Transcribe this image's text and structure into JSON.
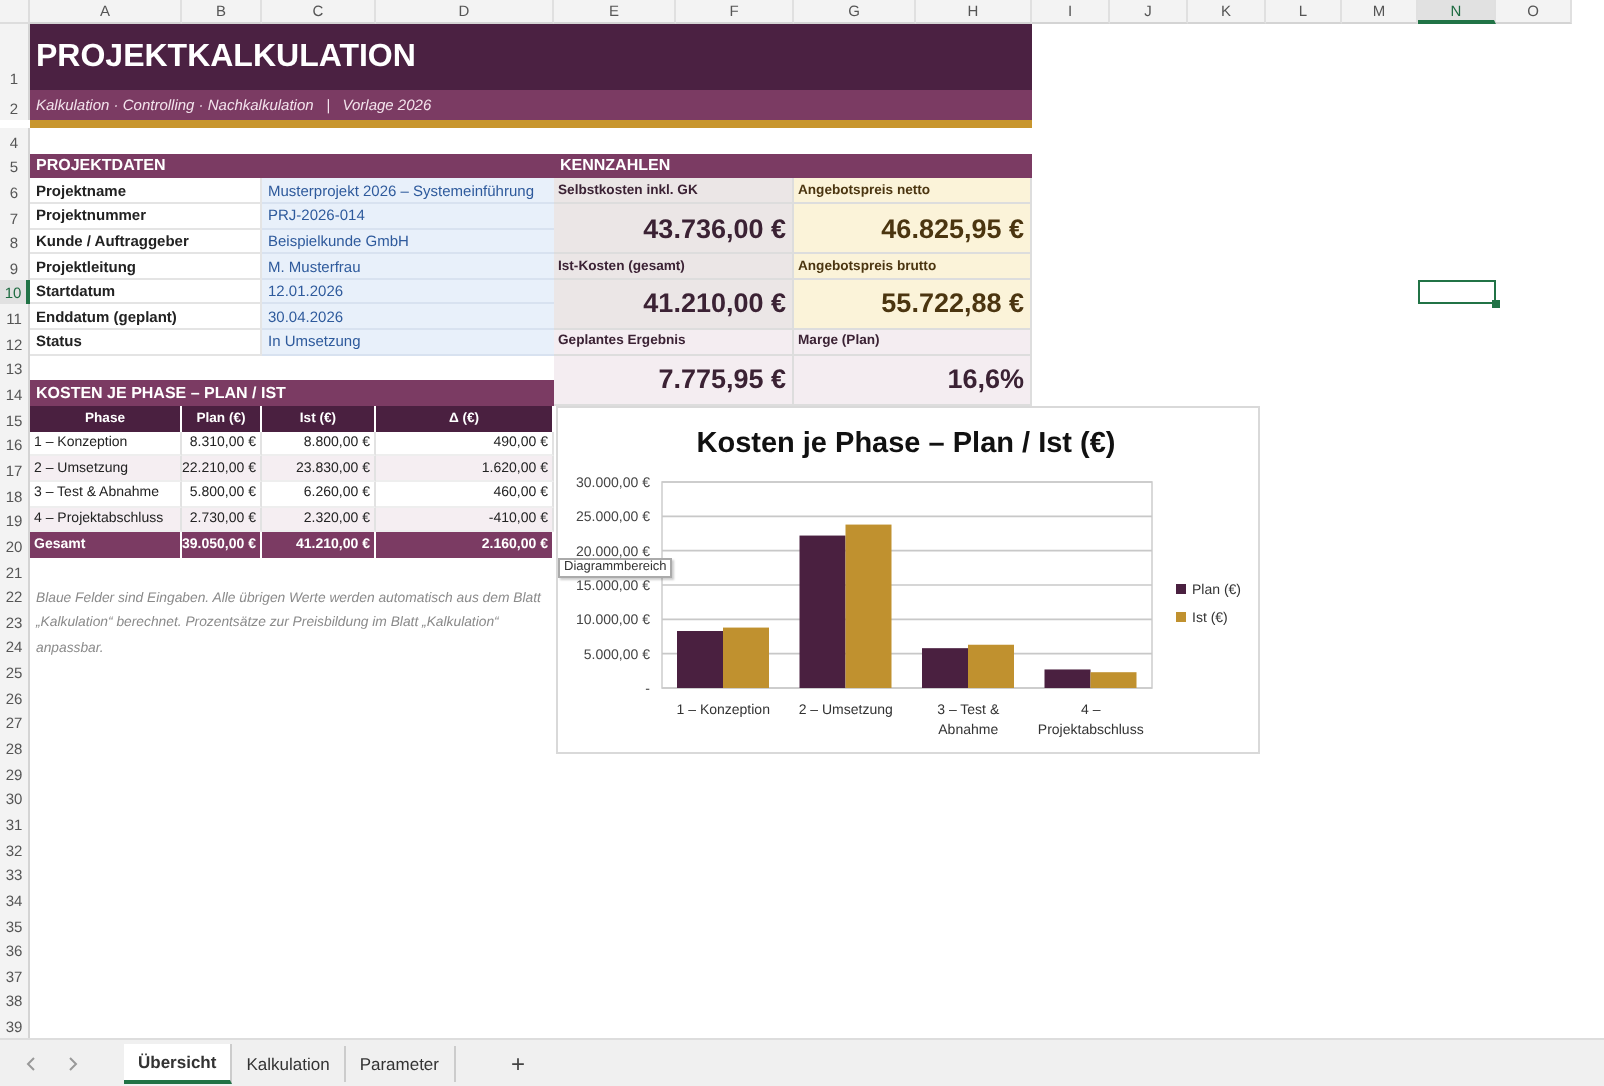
{
  "column_headers": [
    {
      "label": "A",
      "selected": false
    },
    {
      "label": "B",
      "selected": false
    },
    {
      "label": "C",
      "selected": false
    },
    {
      "label": "D",
      "selected": false
    },
    {
      "label": "E",
      "selected": false
    },
    {
      "label": "F",
      "selected": false
    },
    {
      "label": "G",
      "selected": false
    },
    {
      "label": "H",
      "selected": false
    },
    {
      "label": "I",
      "selected": false
    },
    {
      "label": "J",
      "selected": false
    },
    {
      "label": "K",
      "selected": false
    },
    {
      "label": "L",
      "selected": false
    },
    {
      "label": "M",
      "selected": false
    },
    {
      "label": "N",
      "selected": true
    },
    {
      "label": "O",
      "selected": false
    }
  ],
  "row_headers": [
    {
      "label": "1",
      "selected": false
    },
    {
      "label": "2",
      "selected": false
    },
    {
      "label": "4",
      "selected": false
    },
    {
      "label": "5",
      "selected": false
    },
    {
      "label": "6",
      "selected": false
    },
    {
      "label": "7",
      "selected": false
    },
    {
      "label": "8",
      "selected": false
    },
    {
      "label": "9",
      "selected": false
    },
    {
      "label": "10",
      "selected": true
    },
    {
      "label": "11",
      "selected": false
    },
    {
      "label": "12",
      "selected": false
    },
    {
      "label": "13",
      "selected": false
    },
    {
      "label": "14",
      "selected": false
    },
    {
      "label": "15",
      "selected": false
    },
    {
      "label": "16",
      "selected": false
    },
    {
      "label": "17",
      "selected": false
    },
    {
      "label": "18",
      "selected": false
    },
    {
      "label": "19",
      "selected": false
    },
    {
      "label": "20",
      "selected": false
    },
    {
      "label": "21",
      "selected": false
    },
    {
      "label": "22",
      "selected": false
    },
    {
      "label": "23",
      "selected": false
    },
    {
      "label": "24",
      "selected": false
    },
    {
      "label": "25",
      "selected": false
    },
    {
      "label": "26",
      "selected": false
    },
    {
      "label": "27",
      "selected": false
    },
    {
      "label": "28",
      "selected": false
    },
    {
      "label": "29",
      "selected": false
    },
    {
      "label": "30",
      "selected": false
    },
    {
      "label": "31",
      "selected": false
    },
    {
      "label": "32",
      "selected": false
    },
    {
      "label": "33",
      "selected": false
    },
    {
      "label": "34",
      "selected": false
    },
    {
      "label": "35",
      "selected": false
    },
    {
      "label": "36",
      "selected": false
    },
    {
      "label": "37",
      "selected": false
    },
    {
      "label": "38",
      "selected": false
    },
    {
      "label": "39",
      "selected": false
    }
  ],
  "title": "PROJEKTKALKULATION",
  "subtitle": "Kalkulation · Controlling · Nachkalkulation   |   Vorlage 2026",
  "projektdaten": {
    "heading": "PROJEKTDATEN",
    "rows": [
      {
        "label": "Projektname",
        "value": "Musterprojekt 2026 – Systemeinführung"
      },
      {
        "label": "Projektnummer",
        "value": "PRJ-2026-014"
      },
      {
        "label": "Kunde / Auftraggeber",
        "value": "Beispielkunde GmbH"
      },
      {
        "label": "Projektleitung",
        "value": "M. Musterfrau"
      },
      {
        "label": "Startdatum",
        "value": "12.01.2026"
      },
      {
        "label": "Enddatum (geplant)",
        "value": "30.04.2026"
      },
      {
        "label": "Status",
        "value": "In Umsetzung"
      }
    ]
  },
  "kennzahlen": {
    "heading": "KENNZAHLEN",
    "cards": [
      {
        "kind": "cost",
        "label": "Selbstkosten inkl. GK",
        "value": "43.736,00 €"
      },
      {
        "kind": "price",
        "label": "Angebotspreis netto",
        "value": "46.825,95 €"
      },
      {
        "kind": "cost",
        "label": "Ist-Kosten (gesamt)",
        "value": "41.210,00 €"
      },
      {
        "kind": "price",
        "label": "Angebotspreis brutto",
        "value": "55.722,88 €"
      },
      {
        "kind": "result",
        "label": "Geplantes Ergebnis",
        "value": "7.775,95 €"
      },
      {
        "kind": "result",
        "label": "Marge (Plan)",
        "value": "16,6%"
      }
    ]
  },
  "kosten": {
    "heading": "KOSTEN JE PHASE – PLAN / IST",
    "columns": [
      "Phase",
      "Plan (€)",
      "Ist (€)",
      "Δ (€)"
    ],
    "rows": [
      [
        "1 – Konzeption",
        "8.310,00 €",
        "8.800,00 €",
        "490,00 €"
      ],
      [
        "2 – Umsetzung",
        "22.210,00 €",
        "23.830,00 €",
        "1.620,00 €"
      ],
      [
        "3 – Test & Abnahme",
        "5.800,00 €",
        "6.260,00 €",
        "460,00 €"
      ],
      [
        "4 – Projektabschluss",
        "2.730,00 €",
        "2.320,00 €",
        "-410,00 €"
      ]
    ],
    "total": [
      "Gesamt",
      "39.050,00 €",
      "41.210,00 €",
      "2.160,00 €"
    ]
  },
  "note": "Blaue Felder sind Eingaben. Alle übrigen Werte werden automatisch aus dem Blatt „Kalkulation“ berechnet. Prozentsätze zur Preisbildung im Blatt „Kalkulation“ anpassbar.",
  "chart": {
    "chart_data": {
      "type": "bar",
      "title": "Kosten je Phase – Plan / Ist (€)",
      "categories": [
        "1 – Konzeption",
        "2 – Umsetzung",
        "3 – Test & Abnahme",
        "4 – Projektabschluss"
      ],
      "series": [
        {
          "name": "Plan (€)",
          "color": "#4a2040",
          "values": [
            8300,
            22200,
            5800,
            2700
          ]
        },
        {
          "name": "Ist (€)",
          "color": "#c0912f",
          "values": [
            8800,
            23800,
            6300,
            2300
          ]
        }
      ],
      "grid": true,
      "legend": "right",
      "ylim": [
        0,
        30000
      ],
      "yticks": [
        {
          "value": 0,
          "label": "-"
        },
        {
          "value": 5000,
          "label": "5.000,00 €"
        },
        {
          "value": 10000,
          "label": "10.000,00 €"
        },
        {
          "value": 15000,
          "label": "15.000,00 €"
        },
        {
          "value": 20000,
          "label": "20.000,00 €"
        },
        {
          "value": 25000,
          "label": "25.000,00 €"
        },
        {
          "value": 30000,
          "label": "30.000,00 €"
        }
      ]
    },
    "tooltip": "Diagrammbereich"
  },
  "sheet_tabs": [
    {
      "label": "Übersicht",
      "selected": true
    },
    {
      "label": "Kalkulation",
      "selected": false
    },
    {
      "label": "Parameter",
      "selected": false
    }
  ],
  "add_tab": "+"
}
